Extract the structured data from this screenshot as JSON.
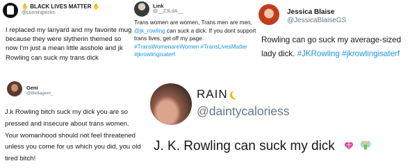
{
  "tweets": [
    {
      "name": "BLACK LIVES MATTER",
      "handle": "@cunningtricks",
      "text": "I replaced my lanyard and my favorite mug because they were slytherin themed so now I'm just a mean little asshole and jk Rowling can suck my trans dick",
      "avatar_icon": "raised-fist-icon"
    },
    {
      "name": "Link",
      "handle": "@__Z3LdA__",
      "text_before_mention": "Trans women are women, Trans men are men, ",
      "mention": "@jk_rowling",
      "text_after_mention": " can suck a dick. If you dont support trans lives, get off my page. ",
      "hashtags": "#TransWomenareWomen #TransLivesMatter #jkrowlingisaterf"
    },
    {
      "name": "Jessica Blaise",
      "handle": "@JessicaBlaiseGS",
      "text": "Rowling can go suck my average-sized lady dick. ",
      "hashtags": "#JKRowling #jkrowlingisaterf"
    },
    {
      "name": "Geni",
      "handle": "@Bellageni_",
      "text": "J.k Rowling bitch suck my dick you are so pressed and insecure about trans women. Your womanhood should not feel threatened unless you come for us which you did, you old tired bitch!"
    },
    {
      "name": "RAIN",
      "handle": "@daintycaloriess",
      "text": "J. K. Rowling can suck my dick",
      "emoji": [
        "heart-with-ribbon-icon",
        "fairy-icon"
      ]
    }
  ],
  "colors": {
    "link": "#1b95e0",
    "handle": "#657786",
    "text": "#14171a"
  }
}
